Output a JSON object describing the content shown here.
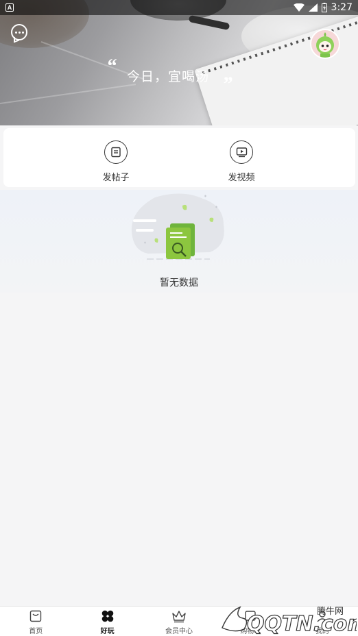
{
  "status_bar": {
    "time": "3:27"
  },
  "hero": {
    "title": "今日，宜喝汤",
    "open_quote": "“",
    "close_quote": "”"
  },
  "actions": [
    {
      "label": "发帖子",
      "icon": "post-icon"
    },
    {
      "label": "发视频",
      "icon": "video-icon"
    }
  ],
  "empty_state": {
    "text": "暂无数据"
  },
  "bottom_nav": {
    "items": [
      {
        "label": "首页",
        "icon": "home-bag-icon",
        "active": false
      },
      {
        "label": "好玩",
        "icon": "clover-icon",
        "active": true
      },
      {
        "label": "会员中心",
        "icon": "crown-icon",
        "active": false
      },
      {
        "label": "购物车",
        "icon": "cart-icon",
        "active": false
      },
      {
        "label": "我的",
        "icon": "user-icon",
        "active": false
      }
    ]
  },
  "watermark": {
    "text": "腾牛网",
    "logo_text": "QQTN.com"
  },
  "colors": {
    "accent_green": "#8cc63f",
    "text_dark": "#333333",
    "page_bg": "#f5f5f6"
  }
}
